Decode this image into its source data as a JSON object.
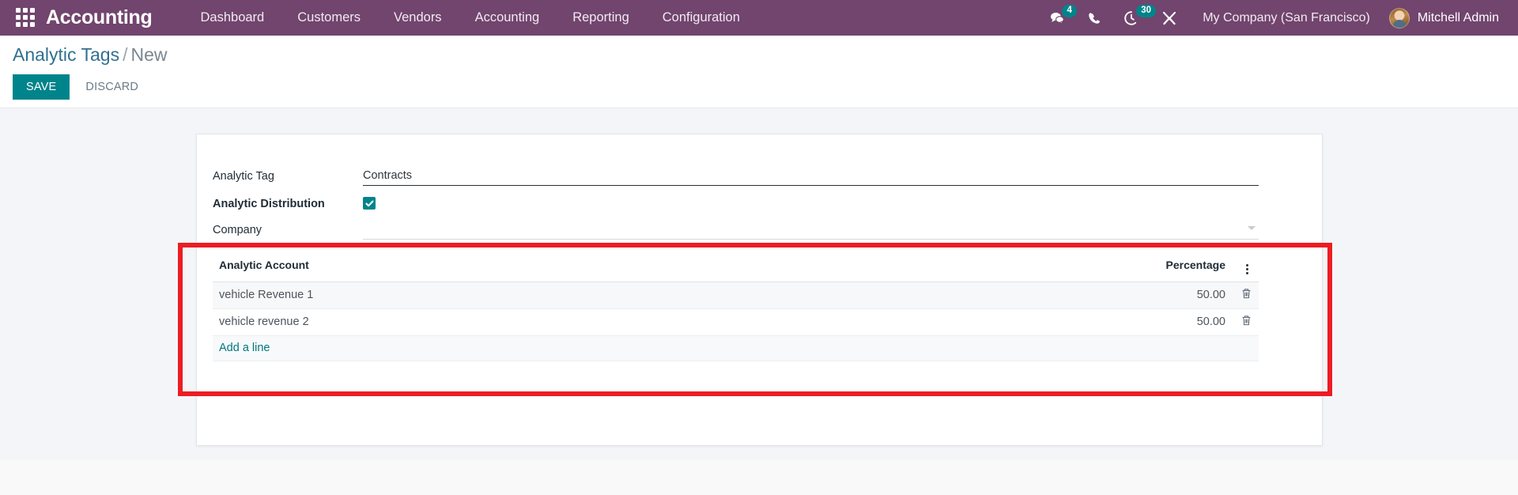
{
  "navbar": {
    "apps_icon": "apps-grid-icon",
    "brand": "Accounting",
    "menu": [
      {
        "label": "Dashboard"
      },
      {
        "label": "Customers"
      },
      {
        "label": "Vendors"
      },
      {
        "label": "Accounting"
      },
      {
        "label": "Reporting"
      },
      {
        "label": "Configuration"
      }
    ],
    "icons": [
      {
        "name": "messages-icon",
        "badge": "4"
      },
      {
        "name": "phone-icon",
        "badge": ""
      },
      {
        "name": "activities-clock-icon",
        "badge": "30"
      },
      {
        "name": "debug-tools-icon",
        "badge": ""
      }
    ],
    "company": "My Company (San Francisco)",
    "user": "Mitchell Admin",
    "accent_purple": "#71456e",
    "badge_color": "#00848b"
  },
  "control_panel": {
    "breadcrumb_root": "Analytic Tags",
    "breadcrumb_separator": "/",
    "breadcrumb_current": "New",
    "save_label": "SAVE",
    "discard_label": "DISCARD",
    "save_color": "#00848b"
  },
  "form": {
    "fields": [
      {
        "label": "Analytic Tag",
        "value": "Contracts",
        "type": "text"
      },
      {
        "label": "Analytic Distribution",
        "value": "",
        "type": "checkbox",
        "checked": true
      },
      {
        "label": "Company",
        "value": "",
        "type": "select",
        "placeholder": ""
      }
    ]
  },
  "o2m_table": {
    "columns": [
      {
        "label": "Analytic Account",
        "align": "left"
      },
      {
        "label": "Percentage",
        "align": "right"
      }
    ],
    "options_icon": "vertical-dots-icon",
    "rows": [
      {
        "account": "vehicle Revenue 1",
        "percentage": "50.00",
        "delete_icon": "trash-icon"
      },
      {
        "account": "vehicle revenue 2",
        "percentage": "50.00",
        "delete_icon": "trash-icon"
      }
    ],
    "add_line_label": "Add a line"
  },
  "annotation": {
    "highlight_color": "#ed1c24"
  }
}
